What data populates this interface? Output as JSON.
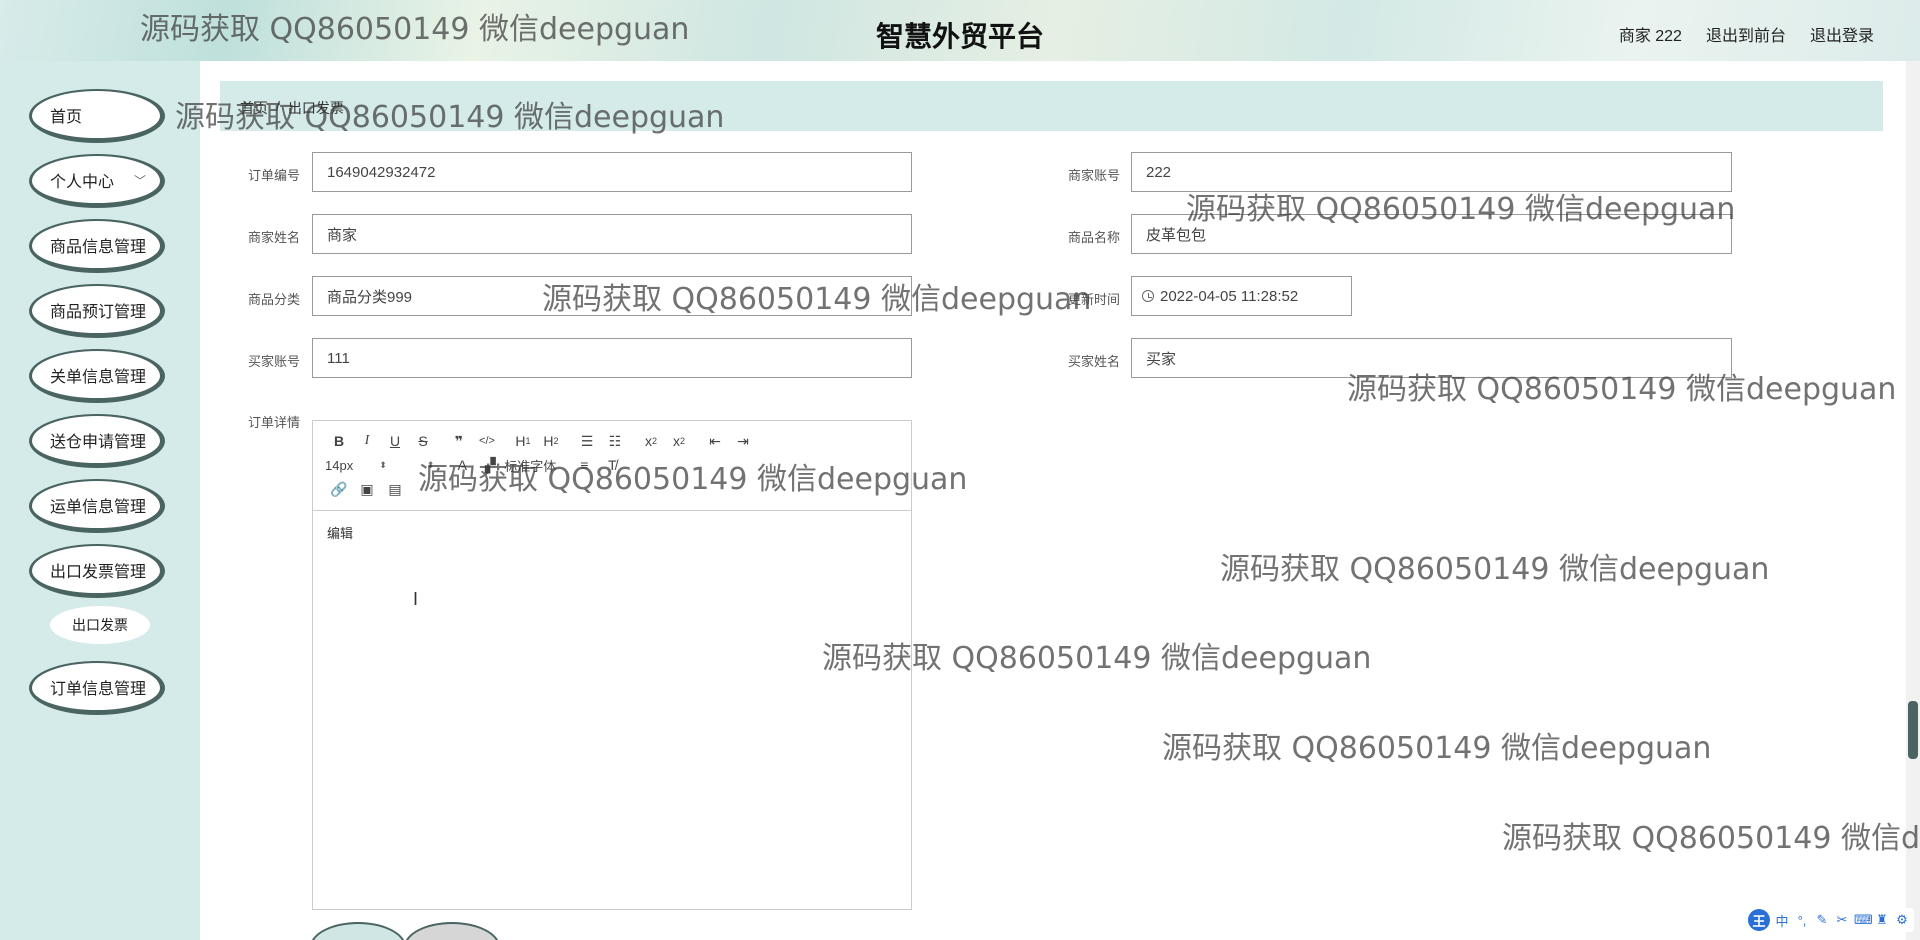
{
  "header": {
    "title": "智慧外贸平台",
    "user_label": "商家 222",
    "exit_front": "退出到前台",
    "logout": "退出登录"
  },
  "sidebar": {
    "items": [
      {
        "label": "首页"
      },
      {
        "label": "个人中心"
      },
      {
        "label": "商品信息管理"
      },
      {
        "label": "商品预订管理"
      },
      {
        "label": "关单信息管理"
      },
      {
        "label": "送仓申请管理"
      },
      {
        "label": "运单信息管理"
      },
      {
        "label": "出口发票管理"
      },
      {
        "label": "订单信息管理"
      }
    ],
    "sub_item": {
      "label": "出口发票"
    }
  },
  "breadcrumb": {
    "home": "首页",
    "separator": "/",
    "current": "出口发票"
  },
  "form": {
    "order_no": {
      "label": "订单编号",
      "value": "1649042932472"
    },
    "merchant_account": {
      "label": "商家账号",
      "value": "222"
    },
    "merchant_name": {
      "label": "商家姓名",
      "value": "商家"
    },
    "product_name": {
      "label": "商品名称",
      "value": "皮革包包"
    },
    "product_category": {
      "label": "商品分类",
      "value": "商品分类999"
    },
    "update_time": {
      "label": "更新时间",
      "value": "2022-04-05 11:28:52"
    },
    "buyer_account": {
      "label": "买家账号",
      "value": "111"
    },
    "buyer_name": {
      "label": "买家姓名",
      "value": "买家"
    },
    "order_detail": {
      "label": "订单详情"
    }
  },
  "editor": {
    "font_size": "14px",
    "font_family": "标准字体",
    "placeholder": "编辑"
  },
  "watermark_text": "源码获取 QQ86050149 微信deepguan",
  "ime": {
    "logo": "王",
    "lang": "中"
  }
}
